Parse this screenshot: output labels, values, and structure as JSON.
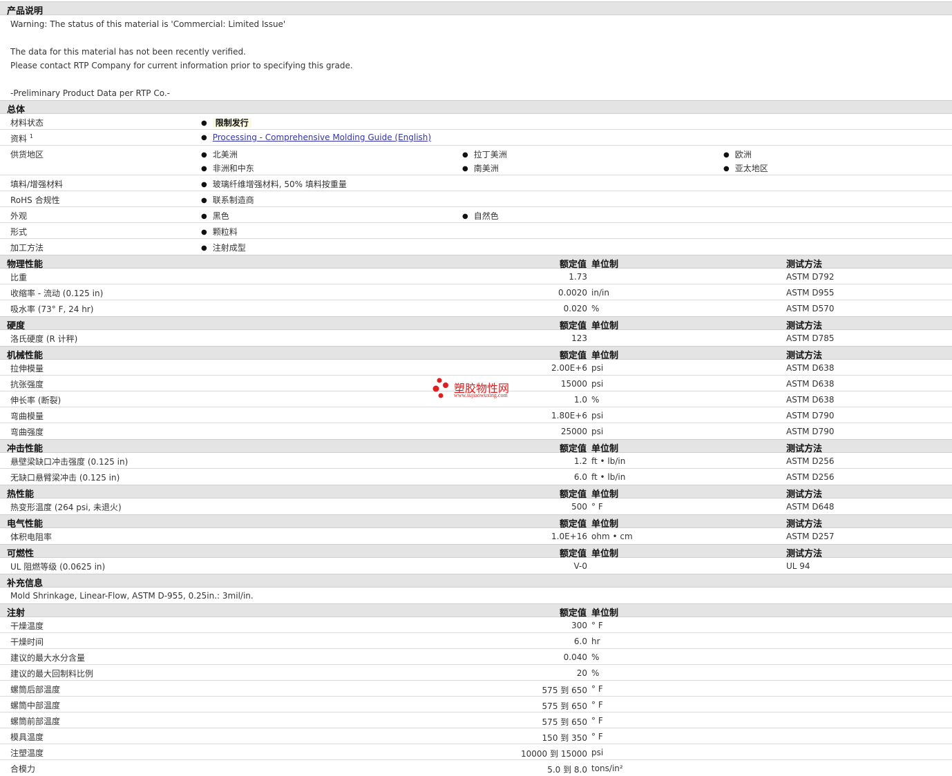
{
  "desc": {
    "title": "产品说明",
    "lines": [
      "Warning: The status of this material is 'Commercial: Limited Issue'",
      "The data for this material has not been recently verified.",
      "Please contact RTP Company for current information prior to specifying this grade.",
      "-Preliminary Product Data per RTP Co.-"
    ]
  },
  "general": {
    "title": "总体",
    "material_status_label": "材料状态",
    "material_status": "限制发行",
    "docs_label": "资料",
    "docs_sup": "1",
    "docs_link": "Processing - Comprehensive Molding Guide (English)",
    "supply_label": "供货地区",
    "supply": [
      "北美洲",
      "拉丁美洲",
      "欧洲",
      "非洲和中东",
      "南美洲",
      "亚太地区"
    ],
    "filler_label": "填料/增强材料",
    "filler": "玻璃纤维增强材料, 50% 填料按重量",
    "rohs_label": "RoHS 合规性",
    "rohs": "联系制造商",
    "appearance_label": "外观",
    "appearance": [
      "黑色",
      "自然色"
    ],
    "form_label": "形式",
    "form": "颗粒料",
    "method_label": "加工方法",
    "method": "注射成型"
  },
  "headers": {
    "value": "额定值",
    "unit": "单位制",
    "method": "测试方法"
  },
  "physical": {
    "title": "物理性能",
    "rows": [
      {
        "label": "比重",
        "value": "1.73",
        "unit": "",
        "method": "ASTM D792"
      },
      {
        "label": "收缩率 - 流动 (0.125 in)",
        "value": "0.0020",
        "unit": "in/in",
        "method": "ASTM D955"
      },
      {
        "label": "吸水率 (73° F, 24 hr)",
        "value": "0.020",
        "unit": "%",
        "method": "ASTM D570"
      }
    ]
  },
  "hardness": {
    "title": "硬度",
    "rows": [
      {
        "label": "洛氏硬度 (R 计秤)",
        "value": "123",
        "unit": "",
        "method": "ASTM D785"
      }
    ]
  },
  "mechanical": {
    "title": "机械性能",
    "rows": [
      {
        "label": "拉伸模量",
        "value": "2.00E+6",
        "unit": "psi",
        "method": "ASTM D638"
      },
      {
        "label": "抗张强度",
        "value": "15000",
        "unit": "psi",
        "method": "ASTM D638"
      },
      {
        "label": "伸长率 (断裂)",
        "value": "1.0",
        "unit": "%",
        "method": "ASTM D638"
      },
      {
        "label": "弯曲模量",
        "value": "1.80E+6",
        "unit": "psi",
        "method": "ASTM D790"
      },
      {
        "label": "弯曲强度",
        "value": "25000",
        "unit": "psi",
        "method": "ASTM D790"
      }
    ]
  },
  "impact": {
    "title": "冲击性能",
    "rows": [
      {
        "label": "悬壁梁缺口冲击强度 (0.125 in)",
        "value": "1.2",
        "unit": "ft • lb/in",
        "method": "ASTM D256"
      },
      {
        "label": "无缺口悬臂梁冲击 (0.125 in)",
        "value": "6.0",
        "unit": "ft • lb/in",
        "method": "ASTM D256"
      }
    ]
  },
  "thermal": {
    "title": "热性能",
    "rows": [
      {
        "label": "热变形温度 (264 psi, 未退火)",
        "value": "500",
        "unit": "° F",
        "method": "ASTM D648"
      }
    ]
  },
  "electrical": {
    "title": "电气性能",
    "rows": [
      {
        "label": "体积电阻率",
        "value": "1.0E+16",
        "unit": "ohm • cm",
        "method": "ASTM D257"
      }
    ]
  },
  "flammability": {
    "title": "可燃性",
    "rows": [
      {
        "label": "UL 阻燃等级 (0.0625 in)",
        "value": "V-0",
        "unit": "",
        "method": "UL 94"
      }
    ]
  },
  "supplement": {
    "title": "补充信息",
    "text": "Mold Shrinkage, Linear-Flow, ASTM D-955, 0.25in.: 3mil/in."
  },
  "injection": {
    "title": "注射",
    "rows": [
      {
        "label": "干燥温度",
        "value": "300",
        "unit": "° F"
      },
      {
        "label": "干燥时间",
        "value": "6.0",
        "unit": "hr"
      },
      {
        "label": "建议的最大水分含量",
        "value": "0.040",
        "unit": "%"
      },
      {
        "label": "建议的最大回制料比例",
        "value": "20",
        "unit": "%"
      },
      {
        "label": "螺筒后部温度",
        "value": "575 到  650",
        "unit": "° F"
      },
      {
        "label": "螺筒中部温度",
        "value": "575 到  650",
        "unit": "° F"
      },
      {
        "label": "螺筒前部温度",
        "value": "575 到  650",
        "unit": "° F"
      },
      {
        "label": "模具温度",
        "value": "150 到  350",
        "unit": "° F"
      },
      {
        "label": "注塑温度",
        "value": "10000 到  15000",
        "unit": "psi"
      },
      {
        "label": "合模力",
        "value": "5.0 到  8.0",
        "unit": "tons/in²"
      }
    ]
  },
  "watermark": {
    "name": "塑胶物性网",
    "url": "www.sujiaowuxing.com"
  }
}
